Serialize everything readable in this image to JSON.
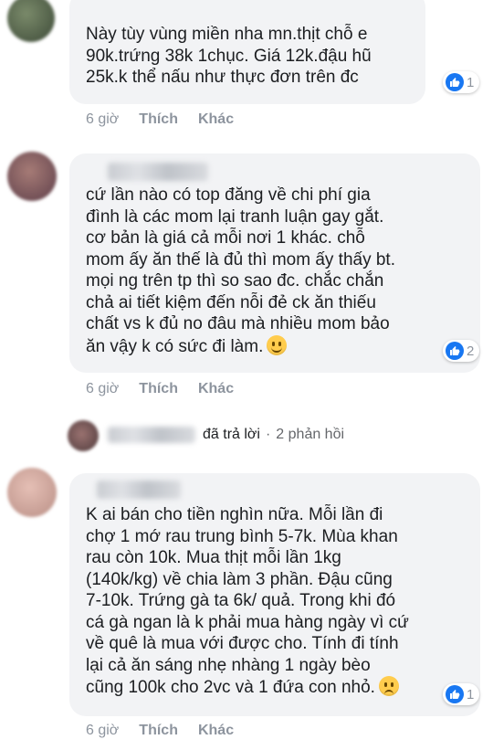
{
  "comments": [
    {
      "text": "Này tùy vùng miền nha mn.thịt chỗ e\n90k.trứng 38k 1chục. Giá 12k.đậu hũ\n25k.k thể nấu như thực đơn trên đc",
      "reactions": "1",
      "time": "6 giờ",
      "like": "Thích",
      "reply": "Khác",
      "emoji": ""
    },
    {
      "text": "cứ lần nào có top đăng về chi phí gia\nđình là các mom lại tranh luận gay gắt.\ncơ bản là giá cả mỗi nơi 1 khác. chỗ\nmom ấy ăn thế là đủ thì mom ấy thấy bt.\nmọi ng trên tp thì so sao đc. chắc chắn\nchả ai tiết kiệm đến nỗi đẻ ck ăn thiếu\nchất vs k đủ no đâu mà nhiều mom bảo\năn vậy k có sức đi làm.",
      "reactions": "2",
      "time": "6 giờ",
      "like": "Thích",
      "reply": "Khác",
      "emoji": "smiling-face-emoji"
    },
    {
      "text": "K ai bán cho tiền nghìn nữa. Mỗi lần đi\nchợ 1 mớ rau trung bình 5-7k. Mùa khan\nrau còn 10k. Mua thịt mỗi lần 1kg\n(140k/kg) về chia làm 3 phần. Đậu cũng\n7-10k. Trứng gà ta 6k/ quả. Trong khi đó\ncá gà ngan là k phải mua hàng ngày vì cứ\nvề quê là mua với được cho. Tính đi tính\nlại cả ăn sáng nhẹ nhàng 1 ngày bèo\ncũng 100k cho 2vc và 1 đứa con nhỏ.",
      "reactions": "1",
      "time": "6 giờ",
      "like": "Thích",
      "reply": "Khác",
      "emoji": "sad-face-emoji"
    }
  ],
  "reply_summary": {
    "action": "đã trả lời",
    "separator": "·",
    "count": "2 phản hồi"
  },
  "colors": {
    "bubble": "#f2f3f5",
    "like_blue": "#1877f2",
    "meta_gray": "#8d949e"
  }
}
